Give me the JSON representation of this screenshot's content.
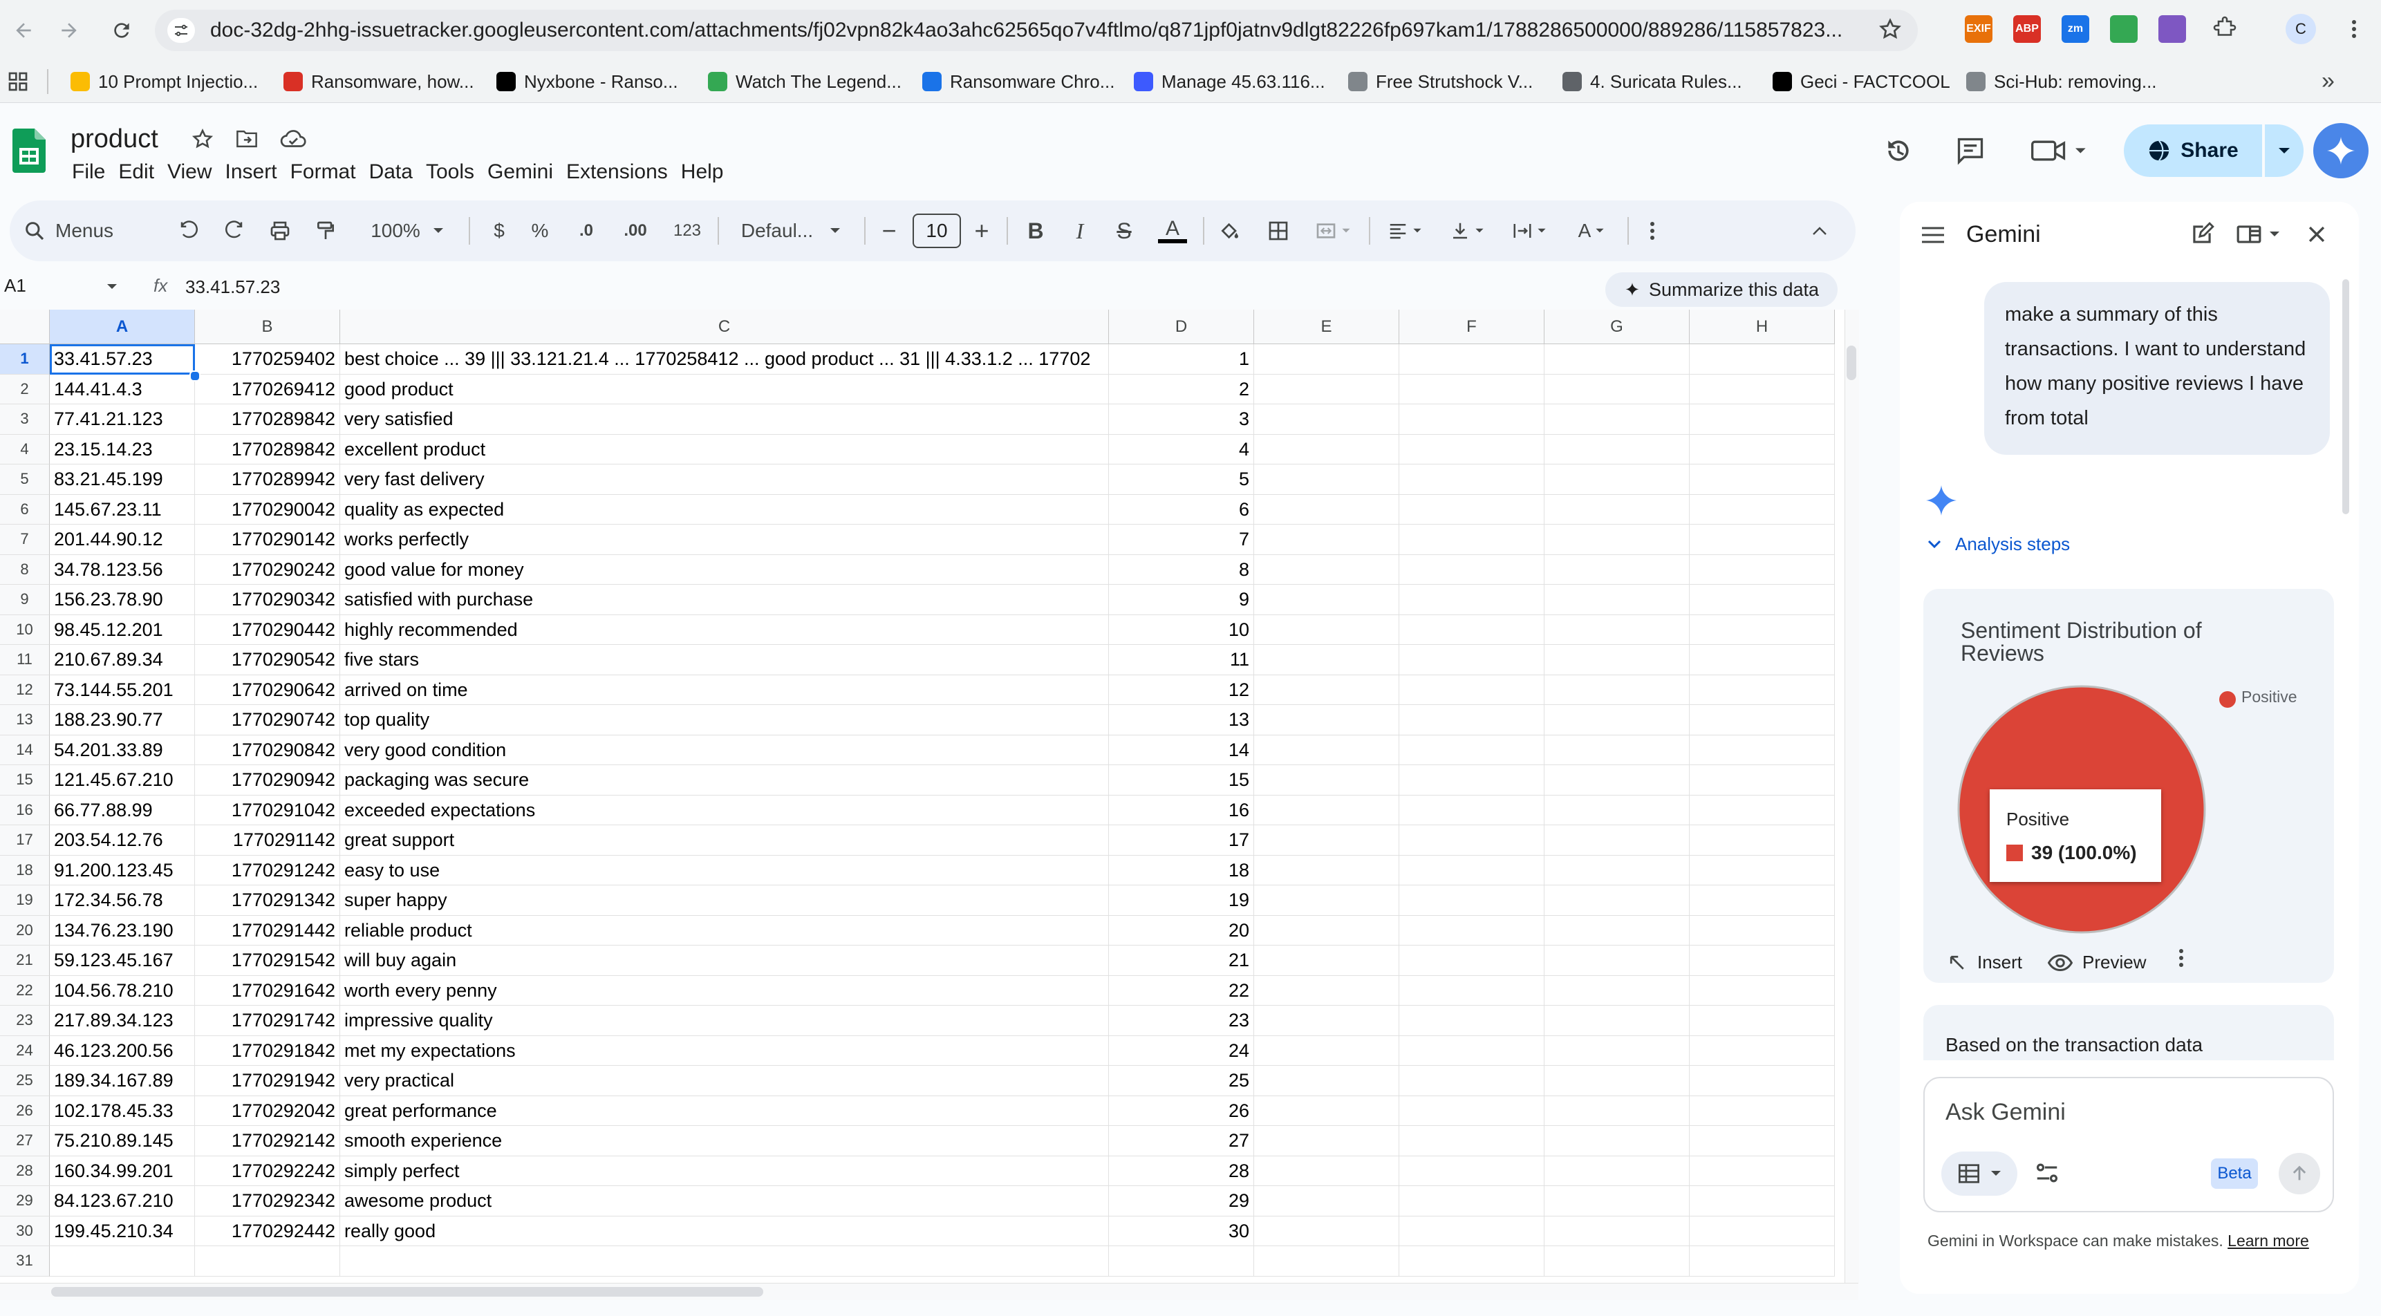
{
  "browser": {
    "url": "doc-32dg-2hhg-issuetracker.googleusercontent.com/attachments/fj02vpn82k4ao3ahc62565qo7v4ftlmo/q871jpf0jatnv9dlgt82226fp697kam1/1788286500000/889286/115857823...",
    "profile_initial": "C",
    "extensions": [
      {
        "name": "exif-icon",
        "label": "EXIF",
        "color": "#e8710a"
      },
      {
        "name": "adblock-icon",
        "label": "ABP",
        "color": "#d93025"
      },
      {
        "name": "zoom-ext-icon",
        "label": "zm",
        "color": "#1a73e8"
      },
      {
        "name": "grid-ext-icon",
        "label": "",
        "color": "#34a853"
      },
      {
        "name": "globe-ext-icon",
        "label": "",
        "color": "#7e57c2"
      }
    ],
    "bookmarks": [
      {
        "label": "10 Prompt Injectio...",
        "color": "#fbbc04"
      },
      {
        "label": "Ransomware, how...",
        "color": "#d93025"
      },
      {
        "label": "Nyxbone - Ranso...",
        "color": "#000000"
      },
      {
        "label": "Watch The Legend...",
        "color": "#34a853"
      },
      {
        "label": "Ransomware Chro...",
        "color": "#1a73e8"
      },
      {
        "label": "Manage 45.63.116...",
        "color": "#3d5afe"
      },
      {
        "label": "Free Strutshock V...",
        "color": "#80868b"
      },
      {
        "label": "4. Suricata Rules...",
        "color": "#5f6368"
      },
      {
        "label": "Geci - FACTCOOL",
        "color": "#000000"
      },
      {
        "label": "Sci-Hub: removing...",
        "color": "#80868b"
      }
    ]
  },
  "sheet": {
    "title": "product",
    "menus": [
      "File",
      "Edit",
      "View",
      "Insert",
      "Format",
      "Data",
      "Tools",
      "Gemini",
      "Extensions",
      "Help"
    ],
    "share_label": "Share",
    "toolbar": {
      "search_label": "Menus",
      "zoom": "100%",
      "currency": "$",
      "percent": "%",
      "dec_decrease": ".0",
      "dec_increase": ".00",
      "number_format": "123",
      "font": "Defaul...",
      "font_size": "10"
    },
    "name_box": "A1",
    "fx_label": "fx",
    "formula_value": "33.41.57.23",
    "summarize_label": "Summarize this data",
    "columns": [
      "A",
      "B",
      "C",
      "D",
      "E",
      "F",
      "G",
      "H"
    ],
    "rows": [
      [
        "33.41.57.23",
        "1770259402",
        "best choice ... 39 ||| 33.121.21.4 ... 1770258412 ... good product ... 31 ||| 4.33.1.2 ... 17702",
        "1"
      ],
      [
        "144.41.4.3",
        "1770269412",
        "good product",
        "2"
      ],
      [
        "77.41.21.123",
        "1770289842",
        "very satisfied",
        "3"
      ],
      [
        "23.15.14.23",
        "1770289842",
        "excellent product",
        "4"
      ],
      [
        "83.21.45.199",
        "1770289942",
        "very fast delivery",
        "5"
      ],
      [
        "145.67.23.11",
        "1770290042",
        "quality as expected",
        "6"
      ],
      [
        "201.44.90.12",
        "1770290142",
        "works perfectly",
        "7"
      ],
      [
        "34.78.123.56",
        "1770290242",
        "good value for money",
        "8"
      ],
      [
        "156.23.78.90",
        "1770290342",
        "satisfied with purchase",
        "9"
      ],
      [
        "98.45.12.201",
        "1770290442",
        "highly recommended",
        "10"
      ],
      [
        "210.67.89.34",
        "1770290542",
        "five stars",
        "11"
      ],
      [
        "73.144.55.201",
        "1770290642",
        "arrived on time",
        "12"
      ],
      [
        "188.23.90.77",
        "1770290742",
        "top quality",
        "13"
      ],
      [
        "54.201.33.89",
        "1770290842",
        "very good condition",
        "14"
      ],
      [
        "121.45.67.210",
        "1770290942",
        "packaging was secure",
        "15"
      ],
      [
        "66.77.88.99",
        "1770291042",
        "exceeded expectations",
        "16"
      ],
      [
        "203.54.12.76",
        "1770291142",
        "great support",
        "17"
      ],
      [
        "91.200.123.45",
        "1770291242",
        "easy to use",
        "18"
      ],
      [
        "172.34.56.78",
        "1770291342",
        "super happy",
        "19"
      ],
      [
        "134.76.23.190",
        "1770291442",
        "reliable product",
        "20"
      ],
      [
        "59.123.45.167",
        "1770291542",
        "will buy again",
        "21"
      ],
      [
        "104.56.78.210",
        "1770291642",
        "worth every penny",
        "22"
      ],
      [
        "217.89.34.123",
        "1770291742",
        "impressive quality",
        "23"
      ],
      [
        "46.123.200.56",
        "1770291842",
        "met my expectations",
        "24"
      ],
      [
        "189.34.167.89",
        "1770291942",
        "very practical",
        "25"
      ],
      [
        "102.178.45.33",
        "1770292042",
        "great performance",
        "26"
      ],
      [
        "75.210.89.145",
        "1770292142",
        "smooth experience",
        "27"
      ],
      [
        "160.34.99.201",
        "1770292242",
        "simply perfect",
        "28"
      ],
      [
        "84.123.67.210",
        "1770292342",
        "awesome product",
        "29"
      ],
      [
        "199.45.210.34",
        "1770292442",
        "really good",
        "30"
      ],
      [
        "",
        "",
        "",
        ""
      ]
    ]
  },
  "gemini": {
    "title": "Gemini",
    "user_message": "make a summary of this transactions. I want to understand how many positive reviews I have from total",
    "analysis_steps_label": "Analysis steps",
    "insert_label": "Insert",
    "preview_label": "Preview",
    "response_preview": "Based on the transaction data",
    "ask_placeholder": "Ask Gemini",
    "beta_label": "Beta",
    "disclaimer": "Gemini in Workspace can make mistakes.",
    "learn_more": "Learn more"
  },
  "chart_data": {
    "type": "pie",
    "title": "Sentiment Distribution of Reviews",
    "slices": [
      {
        "label": "Positive",
        "value": 39,
        "percent": "100.0%",
        "color": "#db4437"
      }
    ],
    "legend": [
      "Positive"
    ],
    "legend_position": "right",
    "tooltip": {
      "label": "Positive",
      "value_text": "39 (100.0%)"
    }
  }
}
